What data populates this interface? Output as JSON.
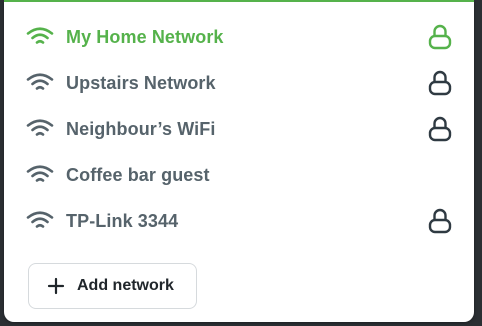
{
  "networks": [
    {
      "name": "My Home Network",
      "secured": true,
      "connected": true
    },
    {
      "name": "Upstairs Network",
      "secured": true,
      "connected": false
    },
    {
      "name": "Neighbour’s WiFi",
      "secured": true,
      "connected": false
    },
    {
      "name": "Coffee bar guest",
      "secured": false,
      "connected": false
    },
    {
      "name": "TP-Link 3344",
      "secured": true,
      "connected": false
    }
  ],
  "add_button": {
    "label": "Add network",
    "icon": "plus-icon"
  },
  "icons": {
    "signal": "wifi-icon",
    "secured": "lock-icon"
  },
  "colors": {
    "accent": "#55b24b",
    "text": "#56636b",
    "lock": "#2f3a42"
  }
}
